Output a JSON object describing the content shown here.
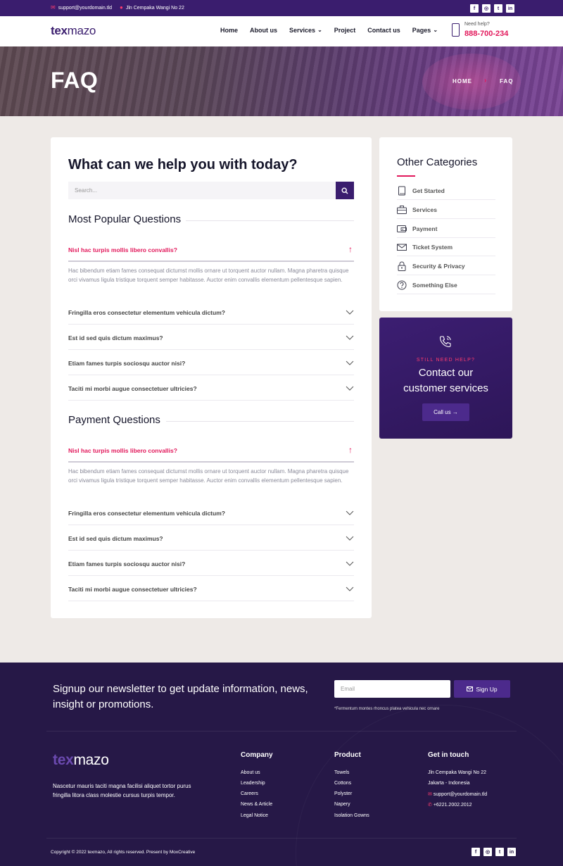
{
  "topbar": {
    "email": "support@yourdomain.tld",
    "address": "Jln Cempaka Wangi No 22",
    "social": [
      "f",
      "◎",
      "t",
      "in"
    ]
  },
  "header": {
    "logo_bold": "tex",
    "logo_rest": "mazo",
    "nav": [
      "Home",
      "About us",
      "Services",
      "Project",
      "Contact us",
      "Pages"
    ],
    "need_help_label": "Need help?",
    "phone": "888-700-234"
  },
  "hero": {
    "title": "FAQ",
    "breadcrumb_home": "HOME",
    "breadcrumb_current": "FAQ"
  },
  "faq": {
    "heading": "What can we help you with today?",
    "search_placeholder": "Search...",
    "sections": [
      {
        "title": "Most Popular Questions",
        "active_question": "Nisl hac turpis mollis libero convallis?",
        "answer": "Hac bibendum etiam fames consequat dictumst mollis ornare ut torquent auctor nullam. Magna pharetra quisque orci vivamus ligula tristique torquent semper habitasse. Auctor enim convallis elementum pellentesque sapien.",
        "questions": [
          "Fringilla eros consectetur elementum vehicula dictum?",
          "Est id sed quis dictum maximus?",
          "Etiam fames turpis sociosqu auctor nisi?",
          "Taciti mi morbi augue consectetuer ultricies?"
        ]
      },
      {
        "title": "Payment Questions",
        "active_question": "Nisl hac turpis mollis libero convallis?",
        "answer": "Hac bibendum etiam fames consequat dictumst mollis ornare ut torquent auctor nullam. Magna pharetra quisque orci vivamus ligula tristique torquent semper habitasse. Auctor enim convallis elementum pellentesque sapien.",
        "questions": [
          "Fringilla eros consectetur elementum vehicula dictum?",
          "Est id sed quis dictum maximus?",
          "Etiam fames turpis sociosqu auctor nisi?",
          "Taciti mi morbi augue consectetuer ultricies?"
        ]
      }
    ]
  },
  "sidebar": {
    "categories_title": "Other Categories",
    "categories": [
      {
        "label": "Get Started",
        "icon": "book-icon"
      },
      {
        "label": "Services",
        "icon": "briefcase-icon"
      },
      {
        "label": "Payment",
        "icon": "wallet-icon"
      },
      {
        "label": "Ticket System",
        "icon": "mail-icon"
      },
      {
        "label": "Security & Privacy",
        "icon": "lock-icon"
      },
      {
        "label": "Something Else",
        "icon": "question-icon"
      }
    ],
    "help_kicker": "STILL NEED HELP?",
    "help_title_1": "Contact our",
    "help_title_2": "customer services",
    "help_button": "Call us →"
  },
  "footer": {
    "newsletter_text": "Signup our newsletter to get update information, news, insight or promotions.",
    "email_placeholder": "Email",
    "signup_button": "Sign Up",
    "note": "*Fermentum montes rhoncus platea vehicula nec ornare",
    "description": "Nascetur mauris taciti magna facilisi aliquet tortor purus fringilla litora class molestie cursus turpis tempor.",
    "company_title": "Company",
    "company_links": [
      "About us",
      "Leadership",
      "Careers",
      "News & Article",
      "Legal Notice"
    ],
    "product_title": "Product",
    "product_links": [
      "Towels",
      "Cottons",
      "Polyster",
      "Napery",
      "Isolation Gowns"
    ],
    "contact_title": "Get in touch",
    "contact_address_1": "Jln Cempaka Wangi No 22",
    "contact_address_2": "Jakarta - Indonesia",
    "contact_email": "support@yourdomain.tld",
    "contact_phone": "+6221.2002.2012",
    "copyright": "Copyright © 2022 texmazo, All rights reserved. Present by MoxCreative"
  },
  "colors": {
    "brand": "#3a1d6e",
    "accent": "#e2185b",
    "footer_bg": "#261847"
  }
}
